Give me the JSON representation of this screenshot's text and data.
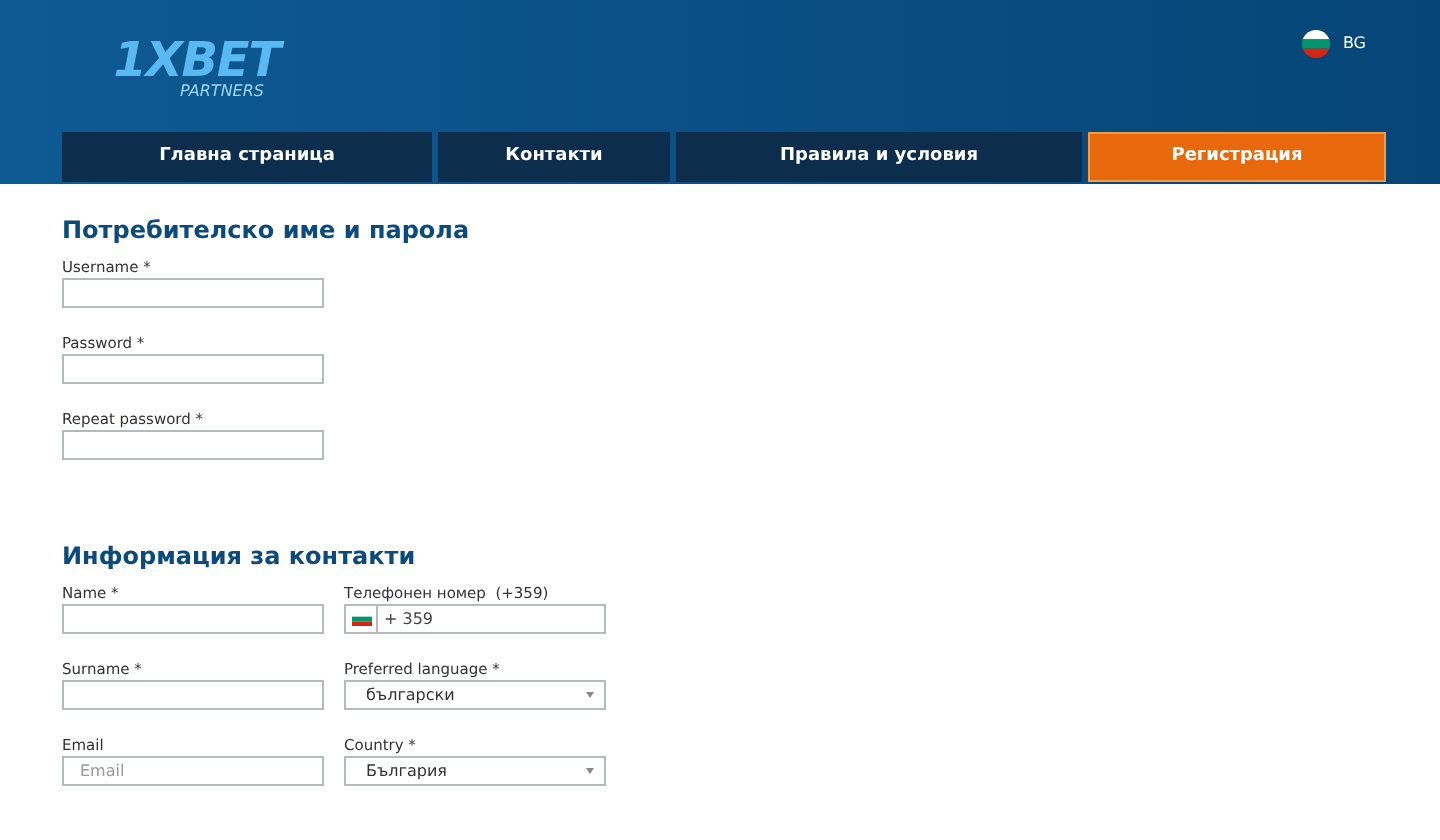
{
  "header": {
    "logo": {
      "brand": "1XBET",
      "sub": "PARTNERS"
    },
    "language": "BG"
  },
  "nav": [
    {
      "label": "Главна страница",
      "selected": false
    },
    {
      "label": "Контакти",
      "selected": false
    },
    {
      "label": "Правила и условия",
      "selected": false
    },
    {
      "label": "Регистрация",
      "selected": true
    }
  ],
  "sections": [
    {
      "title": "Потребителско име и парола",
      "columns": [
        [
          {
            "kind": "text",
            "label": "Username *"
          },
          {
            "kind": "text",
            "label": "Password *"
          },
          {
            "kind": "text",
            "label": "Repeat password *"
          }
        ]
      ]
    },
    {
      "title": "Информация за контакти",
      "columns": [
        [
          {
            "kind": "text",
            "label": "Name *"
          },
          {
            "kind": "text",
            "label": "Surname *"
          },
          {
            "kind": "text",
            "label": "Email",
            "placeholder": "Email"
          }
        ],
        [
          {
            "kind": "phone",
            "label": "Телефонен номер  (+359)",
            "value": "+ 359"
          },
          {
            "kind": "select",
            "label": "Preferred language *",
            "value": "български"
          },
          {
            "kind": "select",
            "label": "Country *",
            "value": "България"
          }
        ]
      ]
    }
  ]
}
